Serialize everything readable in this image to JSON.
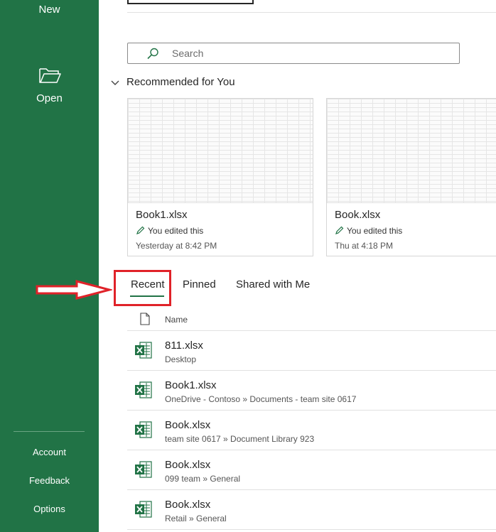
{
  "nav": {
    "new_label": "New",
    "open_label": "Open",
    "account_label": "Account",
    "feedback_label": "Feedback",
    "options_label": "Options",
    "icons": {
      "open": "folder-open-icon"
    },
    "colors": {
      "background": "#217346",
      "text": "#ffffff"
    }
  },
  "search": {
    "placeholder": "Search",
    "value": "",
    "icon": "search-icon"
  },
  "recommended": {
    "heading": "Recommended for You",
    "cards": [
      {
        "title": "Book1.xlsx",
        "activity": "You edited this",
        "time": "Yesterday at 8:42 PM"
      },
      {
        "title": "Book.xlsx",
        "activity": "You edited this",
        "time": "Thu at 4:18 PM"
      }
    ]
  },
  "tabs": {
    "items": [
      {
        "label": "Recent",
        "active": true
      },
      {
        "label": "Pinned",
        "active": false
      },
      {
        "label": "Shared with Me",
        "active": false
      }
    ],
    "highlight_color": "#e02229",
    "accent": "#217346"
  },
  "file_list": {
    "column_name": "Name",
    "rows": [
      {
        "name": "811.xlsx",
        "path": "Desktop"
      },
      {
        "name": "Book1.xlsx",
        "path": "OneDrive - Contoso » Documents - team site 0617"
      },
      {
        "name": "Book.xlsx",
        "path": "team site 0617 » Document Library 923"
      },
      {
        "name": "Book.xlsx",
        "path": "099 team » General"
      },
      {
        "name": "Book.xlsx",
        "path": "Retail » General"
      }
    ]
  }
}
